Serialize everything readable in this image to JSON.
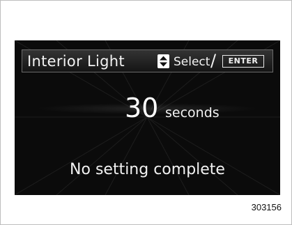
{
  "header": {
    "title": "Interior Light",
    "select_label": "Select",
    "separator": "/",
    "enter_key": "ENTER",
    "nav_icon": "up-down-arrows-icon"
  },
  "setting": {
    "value": "30",
    "unit": "seconds"
  },
  "status": {
    "message": "No setting complete"
  },
  "figure": {
    "number": "303156"
  },
  "colors": {
    "screen_background": "#0b0b0b",
    "text": "#f2f2f2",
    "page_background": "#ffffff"
  }
}
